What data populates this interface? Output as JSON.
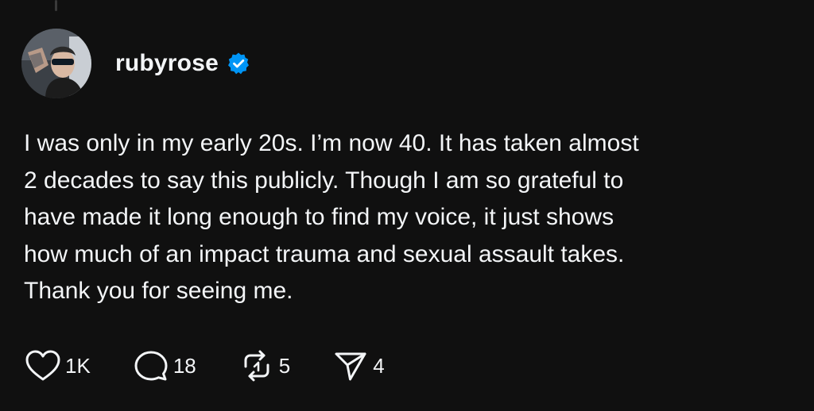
{
  "post": {
    "username": "rubyrose",
    "verified": true,
    "text": "I was only in my early 20s. I’m now 40. It has taken almost\n2 decades to say this publicly. Though I am so grateful to\nhave made it long enough to find my voice, it just shows\nhow much of an impact trauma and sexual assault takes.\nThank you for seeing me."
  },
  "actions": {
    "like": {
      "icon": "heart-icon",
      "count": "1K"
    },
    "reply": {
      "icon": "comment-icon",
      "count": "18"
    },
    "repost": {
      "icon": "repost-icon",
      "count": "5"
    },
    "share": {
      "icon": "send-icon",
      "count": "4"
    }
  },
  "colors": {
    "background": "#101010",
    "text": "#f3f5f7",
    "verified_badge": "#0095f6"
  }
}
